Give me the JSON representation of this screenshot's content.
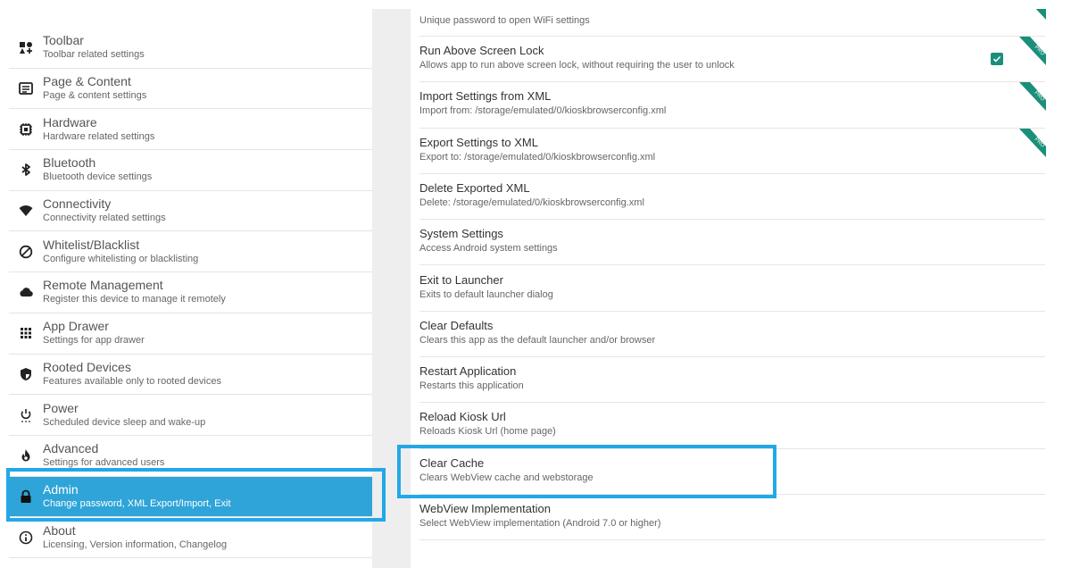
{
  "sidebar": {
    "items": [
      {
        "title": "Toolbar",
        "subtitle": "Toolbar related settings",
        "icon": "toolbar-icon"
      },
      {
        "title": "Page & Content",
        "subtitle": "Page & content settings",
        "icon": "page-content-icon"
      },
      {
        "title": "Hardware",
        "subtitle": "Hardware related settings",
        "icon": "chip-icon"
      },
      {
        "title": "Bluetooth",
        "subtitle": "Bluetooth device settings",
        "icon": "bluetooth-icon"
      },
      {
        "title": "Connectivity",
        "subtitle": "Connectivity related settings",
        "icon": "wifi-icon"
      },
      {
        "title": "Whitelist/Blacklist",
        "subtitle": "Configure whitelisting or blacklisting",
        "icon": "block-icon"
      },
      {
        "title": "Remote Management",
        "subtitle": "Register this device to manage it remotely",
        "icon": "cloud-icon"
      },
      {
        "title": "App Drawer",
        "subtitle": "Settings for app drawer",
        "icon": "grid-icon"
      },
      {
        "title": "Rooted Devices",
        "subtitle": "Features available only to rooted devices",
        "icon": "shield-icon"
      },
      {
        "title": "Power",
        "subtitle": "Scheduled device sleep and wake-up",
        "icon": "power-icon"
      },
      {
        "title": "Advanced",
        "subtitle": "Settings for advanced users",
        "icon": "flame-icon"
      },
      {
        "title": "Admin",
        "subtitle": "Change password, XML Export/Import, Exit",
        "icon": "lock-icon"
      },
      {
        "title": "About",
        "subtitle": "Licensing, Version information, Changelog",
        "icon": "info-icon"
      }
    ],
    "active_index": 11
  },
  "settings": [
    {
      "title": "",
      "subtitle": "Unique password to open WiFi settings"
    },
    {
      "title": "Run Above Screen Lock",
      "subtitle": "Allows app to run above screen lock, without requiring the user to unlock",
      "checked": true,
      "pro": true
    },
    {
      "title": "Import Settings from XML",
      "subtitle": "Import from: /storage/emulated/0/kioskbrowserconfig.xml",
      "pro": true
    },
    {
      "title": "Export Settings to XML",
      "subtitle": "Export to: /storage/emulated/0/kioskbrowserconfig.xml",
      "pro": true
    },
    {
      "title": "Delete Exported XML",
      "subtitle": "Delete: /storage/emulated/0/kioskbrowserconfig.xml"
    },
    {
      "title": "System Settings",
      "subtitle": "Access Android system settings"
    },
    {
      "title": "Exit to Launcher",
      "subtitle": "Exits to default launcher dialog"
    },
    {
      "title": "Clear Defaults",
      "subtitle": "Clears this app as the default launcher and/or browser"
    },
    {
      "title": "Restart Application",
      "subtitle": "Restarts this application"
    },
    {
      "title": "Reload Kiosk Url",
      "subtitle": "Reloads Kiosk Url (home page)"
    },
    {
      "title": "Clear Cache",
      "subtitle": "Clears WebView cache and webstorage"
    },
    {
      "title": "WebView Implementation",
      "subtitle": "Select WebView implementation (Android 7.0 or higher)"
    }
  ],
  "pro_badge": "PRO",
  "colors": {
    "active_bg": "#2fa4d8",
    "highlight": "#22a8e6",
    "checkbox": "#1a8f7a",
    "ribbon": "#1a8f7a"
  }
}
